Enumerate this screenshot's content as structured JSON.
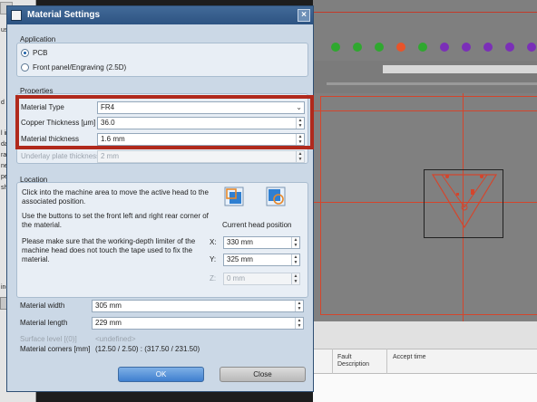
{
  "dialog": {
    "title": "Material Settings",
    "close_glyph": "×"
  },
  "application": {
    "title": "Application",
    "options": [
      {
        "label": "PCB",
        "selected": true
      },
      {
        "label": "Front panel/Engraving (2.5D)",
        "selected": false
      }
    ]
  },
  "properties": {
    "title": "Properties",
    "material_type_label": "Material Type",
    "material_type_value": "FR4",
    "copper_label": "Copper Thickness [µm]",
    "copper_value": "36.0",
    "thickness_label": "Material thickness",
    "thickness_value": "1.6 mm",
    "underlay_label": "Underlay plate thickness",
    "underlay_value": "2 mm"
  },
  "location": {
    "title": "Location",
    "instruction_1": "Click into the machine area to move the active head to the associated position.",
    "instruction_2": "Use the buttons to set the front left and right rear corner of the material.",
    "instruction_3": "Please make sure that the working-depth limiter of the machine head does not touch the tape used to fix the material.",
    "current_head_label": "Current head position",
    "x_label": "X:",
    "x_value": "330 mm",
    "y_label": "Y:",
    "y_value": "325 mm",
    "z_label": "Z:",
    "z_value": "0 mm"
  },
  "material": {
    "width_label": "Material width",
    "width_value": "305 mm",
    "length_label": "Material length",
    "length_value": "229 mm",
    "surface_label": "Surface level [(0)]",
    "surface_value": "<undefined>",
    "corners_label": "Material corners [mm]",
    "corners_value": "(12.50 / 2.50) : (317.50 / 231.50)"
  },
  "buttons": {
    "ok": "OK",
    "close": "Close"
  },
  "background": {
    "columns": [
      "Fault Description",
      "Accept time"
    ],
    "dot_colors": [
      "#2fa82f",
      "#2fa82f",
      "#2fa82f",
      "#e8542a",
      "#2fa82f",
      "#7b2fb8",
      "#7b2fb8",
      "#7b2fb8",
      "#7b2fb8",
      "#7b2fb8",
      "#7b2fb8"
    ],
    "left_fragments": [
      "use",
      "d a",
      "l in",
      "dat",
      "rat",
      "nec",
      "per",
      "sh",
      "ing"
    ]
  }
}
